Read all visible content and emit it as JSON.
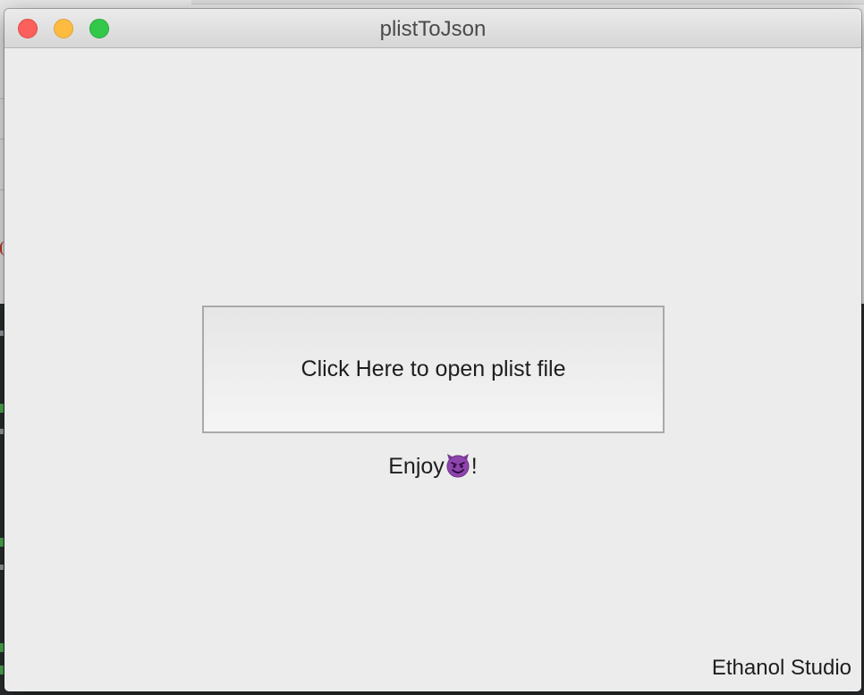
{
  "window": {
    "title": "plistToJson"
  },
  "main": {
    "open_button_label": "Click Here to open plist file",
    "enjoy_text": "Enjoy",
    "enjoy_suffix": "!",
    "enjoy_icon": "smiling-devil-icon",
    "footer_label": "Ethanol Studio"
  },
  "colors": {
    "close": "#fc605c",
    "minimize": "#fdbc40",
    "zoom": "#34c84a",
    "window_bg": "#ececec",
    "devil": "#8e44ad"
  }
}
